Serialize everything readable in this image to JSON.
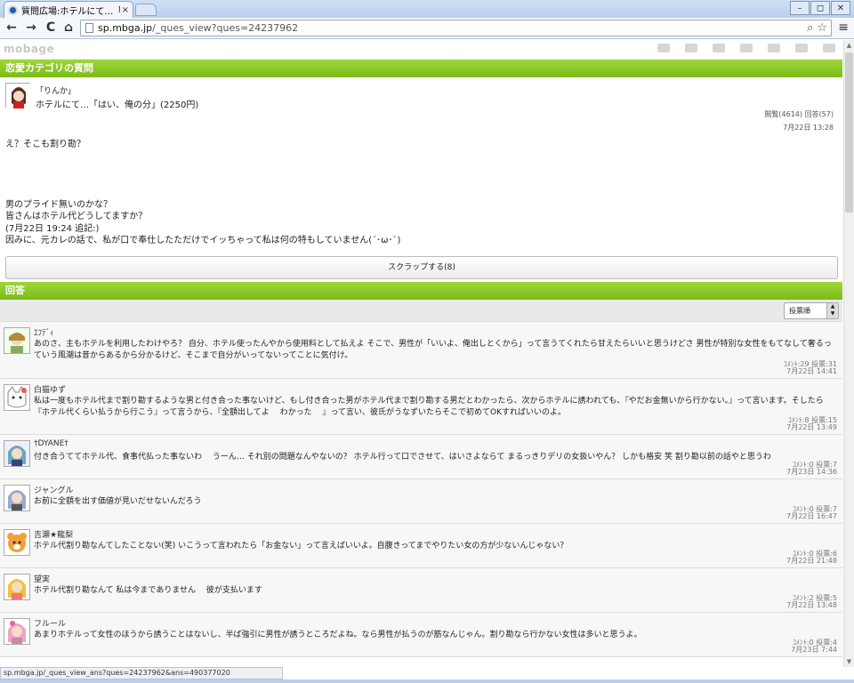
{
  "browser": {
    "tab_title": "質問広場:ホテルにて…「はい",
    "tab_close": "×",
    "url_host": "sp.mbga.jp",
    "url_path": "/_ques_view?ques=24237962",
    "status_url": "sp.mbga.jp/_ques_view_ans?ques=24237962&ans=490377020",
    "nav": {
      "back": "←",
      "forward": "→",
      "reload": "C",
      "home": "⌂"
    },
    "window": {
      "minimize": "–",
      "restore": "◻",
      "close": "✕"
    }
  },
  "site": {
    "logo": "mobage",
    "icons": [
      "pen-icon",
      "car-icon",
      "car2-icon",
      "book-icon",
      "game-icon",
      "mail-icon",
      "menu-grid-icon"
    ]
  },
  "question_section": {
    "header": "恋愛カテゴリの質問",
    "user": "「りんか」",
    "title": "ホテルにて…「はい、俺の分」(2250円)",
    "stats": "閲覧(4614) 回答(57)",
    "date": "7月22日 13:28",
    "body": [
      "え？そこも割り勘？",
      "",
      "",
      "",
      "",
      "男のプライド無いのかな？",
      "皆さんはホテル代どうしてますか？",
      "(7月22日 19:24 追記:)",
      "因みに、元カレの話で、私が口で奉仕したただけでイッちゃって私は何の特もしていません(´･ω･`)"
    ],
    "scrap_button": "スクラップする(8)"
  },
  "answers_section": {
    "header": "回答",
    "sort_label": "投票順",
    "answers": [
      {
        "user": "ｴﾌﾃﾞｨ",
        "text": "あのさ、主もホテルを利用したわけやろ？ 自分、ホテル使ったんやから使用料として払えよ そこで、男性が「いいよ、俺出しとくから」って言うてくれたら甘えたらいいと思うけどさ 男性が特別な女性をもてなして奢るっていう風潮は昔からあるから分かるけど、そこまで自分がいってないってことに気付け。",
        "meta": "ｺﾒﾝﾄ:29 投票:31",
        "date": "7月22日 14:41"
      },
      {
        "user": "白猫ゆず",
        "text": "私は一度もホテル代まで割り勘するような男と付き合った事ないけど、もし付き合った男がホテル代まで割り勘する男だとわかったら、次からホテルに誘われても、『やだお金無いから行かない。』って言います。そしたら『ホテル代くらい払うから行こう』って言うから、『全額出してよ 　わかった 　』って言い、彼氏がうなずいたらそこで初めてOKすればいいのよ。",
        "meta": "ｺﾒﾝﾄ:8 投票:15",
        "date": "7月22日 13:49"
      },
      {
        "user": "†DYANE†",
        "text": "付き合うててホテル代、食事代払った事ないわ 　うーん… それ別の問題なんやないの？ ホテル行って口でさせて、はいさよならて まるっきりデリの女扱いやん？ しかも格安 笑 割り勘以前の話やと思うわ",
        "meta": "ｺﾒﾝﾄ:0 投票:7",
        "date": "7月23日 14:36"
      },
      {
        "user": "ジャングル",
        "text": "お前に全額を出す価値が見いだせないんだろう",
        "meta": "ｺﾒﾝﾄ:0 投票:7",
        "date": "7月22日 16:47"
      },
      {
        "user": "吉瀬★龍梨",
        "text": "ホテル代割り勘なんてしたことない(笑) いこうって言われたら「お金ない」って言えばいいよ。自腹きってまでやりたい女の方が少ないんじゃない？",
        "meta": "ｺﾒﾝﾄ:0 投票:6",
        "date": "7月22日 21:48"
      },
      {
        "user": "望実",
        "text": "ホテル代割り勘なんて 私は今までありません 　彼が支払います",
        "meta": "ｺﾒﾝﾄ:2 投票:5",
        "date": "7月22日 13:48"
      },
      {
        "user": "フルール",
        "text": "あまりホテルって女性のほうから誘うことはないし、半ば強引に男性が誘うところだよね。なら男性が払うのが筋なんじゃん。割り勘なら行かない女性は多いと思うよ。",
        "meta": "ｺﾒﾝﾄ:0 投票:4",
        "date": "7月23日 7:44"
      }
    ]
  }
}
